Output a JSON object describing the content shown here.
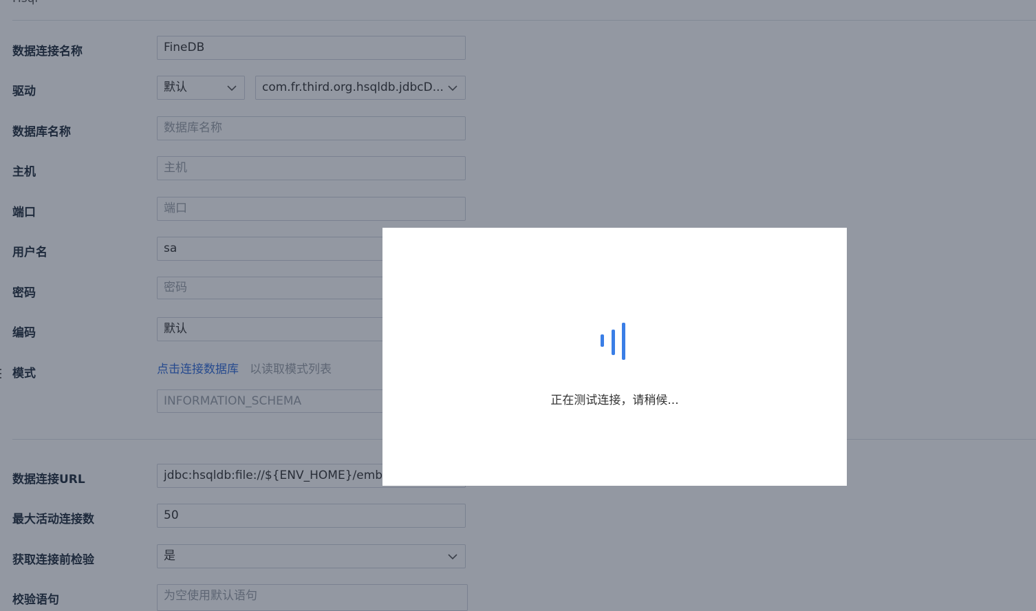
{
  "header": {
    "title": "Hsql"
  },
  "form": {
    "connection_name": {
      "label": "数据连接名称",
      "value": "FineDB"
    },
    "driver": {
      "label": "驱动",
      "type_value": "默认",
      "class_value": "com.fr.third.org.hsqldb.jdbcD..."
    },
    "database_name": {
      "label": "数据库名称",
      "placeholder": "数据库名称"
    },
    "host": {
      "label": "主机",
      "placeholder": "主机"
    },
    "port": {
      "label": "端口",
      "placeholder": "端口"
    },
    "username": {
      "label": "用户名",
      "value": "sa"
    },
    "password": {
      "label": "密码",
      "placeholder": "密码"
    },
    "encoding": {
      "label": "编码",
      "value": "默认"
    },
    "schema": {
      "label": "模式",
      "link": "点击连接数据库",
      "hint": "以读取模式列表",
      "value": "INFORMATION_SCHEMA"
    },
    "url": {
      "label": "数据连接URL",
      "value": "jdbc:hsqldb:file://${ENV_HOME}/emb"
    },
    "max_active": {
      "label": "最大活动连接数",
      "value": "50"
    },
    "validate_on_borrow": {
      "label": "获取连接前检验",
      "value": "是"
    },
    "validation_query": {
      "label": "校验语句",
      "placeholder": "为空使用默认语句"
    }
  },
  "dialog": {
    "message": "正在测试连接，请稍候..."
  },
  "colors": {
    "accent": "#3a7ee6",
    "link": "#2f6ad9",
    "overlay": "rgba(30,40,60,0.48)"
  }
}
